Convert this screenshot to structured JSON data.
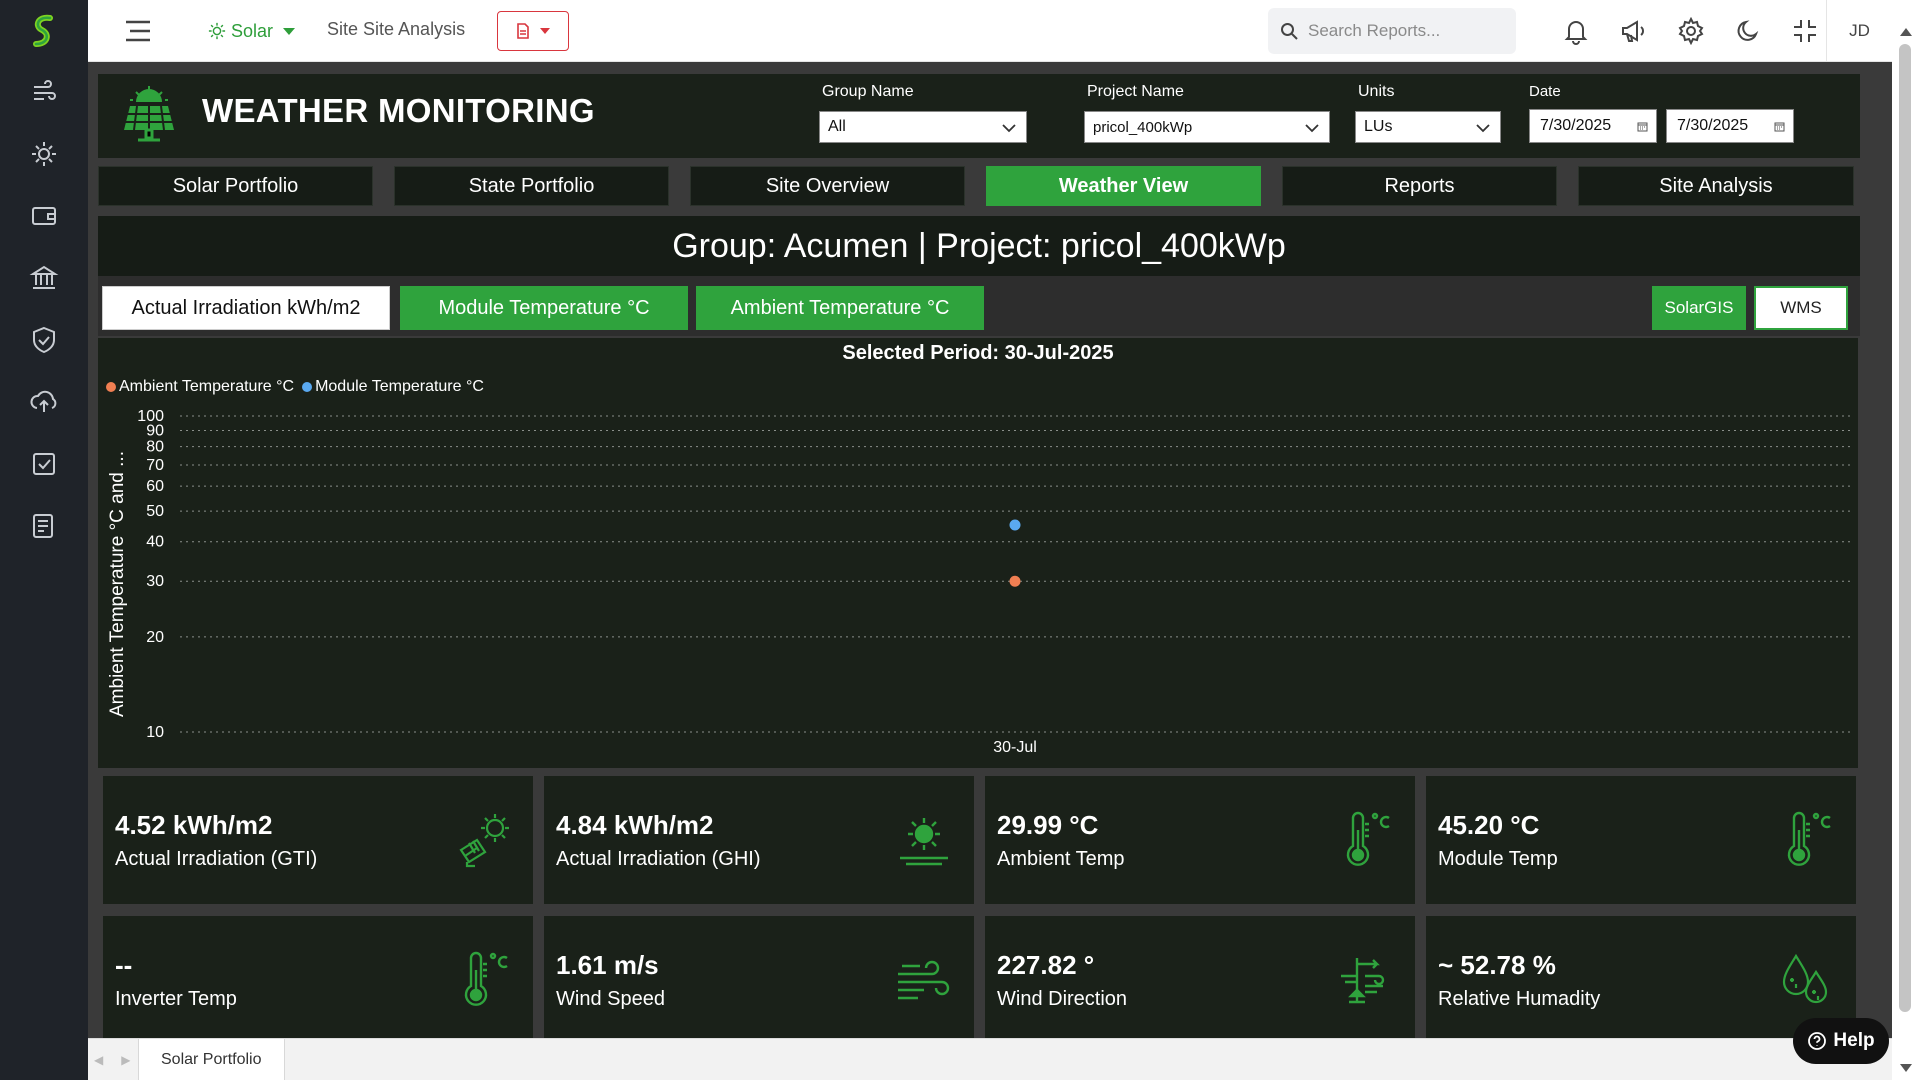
{
  "topbar": {
    "module": "Solar",
    "page_link": "Site Site Analysis",
    "search_placeholder": "Search Reports...",
    "user_initials": "JD"
  },
  "header": {
    "title": "WEATHER MONITORING",
    "group_label": "Group Name",
    "group_value": "All",
    "project_label": "Project Name",
    "project_value": "pricol_400kWp",
    "units_label": "Units",
    "units_value": "LUs",
    "date_label": "Date",
    "date_from": "7/30/2025",
    "date_to": "7/30/2025"
  },
  "tabs": [
    {
      "label": "Solar Portfolio"
    },
    {
      "label": "State Portfolio"
    },
    {
      "label": "Site Overview"
    },
    {
      "label": "Weather View",
      "active": true
    },
    {
      "label": "Reports"
    },
    {
      "label": "Site Analysis"
    }
  ],
  "banner": "Group: Acumen | Project: pricol_400kWp",
  "toggles": {
    "irradiation": "Actual Irradiation kWh/m2",
    "module_temp": "Module Temperature °C",
    "ambient_temp": "Ambient Temperature °C",
    "solargis": "SolarGIS",
    "wms": "WMS"
  },
  "chart_data": {
    "type": "scatter",
    "title": "Selected Period: 30-Jul-2025",
    "ylabel": "Ambient Temperature °C and ...",
    "x": [
      "30-Jul"
    ],
    "y_scale": "log",
    "ylim": [
      10,
      100
    ],
    "y_ticks": [
      10,
      20,
      30,
      40,
      50,
      60,
      70,
      80,
      90,
      100
    ],
    "grid": true,
    "legend_position": "top-left",
    "series": [
      {
        "name": "Ambient Temperature °C",
        "color": "#f07f52",
        "values": [
          29.99
        ]
      },
      {
        "name": "Module Temperature °C",
        "color": "#5aa9f0",
        "values": [
          45.2
        ]
      }
    ]
  },
  "kpis": [
    {
      "value": "4.52 kWh/m2",
      "label": "Actual Irradiation (GTI)",
      "icon": "solar-panel-sun-icon"
    },
    {
      "value": "4.84 kWh/m2",
      "label": "Actual Irradiation (GHI)",
      "icon": "sun-horizon-icon"
    },
    {
      "value": "29.99 °C",
      "label": "Ambient Temp",
      "icon": "thermometer-celsius-icon"
    },
    {
      "value": "45.20 °C",
      "label": "Module Temp",
      "icon": "thermometer-celsius-icon"
    },
    {
      "value": "--",
      "label": "Inverter Temp",
      "icon": "thermometer-celsius-icon"
    },
    {
      "value": "1.61 m/s",
      "label": "Wind Speed",
      "icon": "wind-icon"
    },
    {
      "value": "227.82 °",
      "label": "Wind Direction",
      "icon": "wind-direction-icon"
    },
    {
      "value": "~ 52.78 %",
      "label": "Relative Humadity",
      "icon": "humidity-drops-icon"
    }
  ],
  "bottom_tab": "Solar Portfolio",
  "help_label": "Help",
  "colors": {
    "accent": "#2fa33d",
    "panel": "#1a2119",
    "rail": "#1f2329"
  }
}
